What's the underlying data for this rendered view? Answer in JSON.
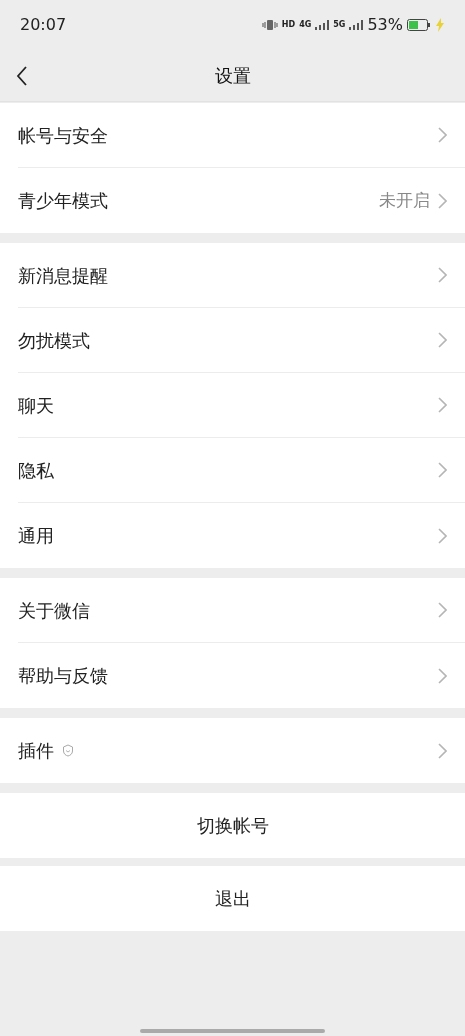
{
  "status_bar": {
    "time": "20:07",
    "network_labels": [
      "HD",
      "4G",
      "5G"
    ],
    "battery": "53%"
  },
  "nav": {
    "title": "设置"
  },
  "groups": [
    {
      "items": [
        {
          "kind": "link",
          "label": "帐号与安全"
        },
        {
          "kind": "link",
          "label": "青少年模式",
          "value": "未开启"
        }
      ]
    },
    {
      "items": [
        {
          "kind": "link",
          "label": "新消息提醒"
        },
        {
          "kind": "link",
          "label": "勿扰模式"
        },
        {
          "kind": "link",
          "label": "聊天"
        },
        {
          "kind": "link",
          "label": "隐私"
        },
        {
          "kind": "link",
          "label": "通用"
        }
      ]
    },
    {
      "items": [
        {
          "kind": "link",
          "label": "关于微信"
        },
        {
          "kind": "link",
          "label": "帮助与反馈"
        }
      ]
    },
    {
      "items": [
        {
          "kind": "shield",
          "label": "插件"
        }
      ]
    }
  ],
  "actions": [
    {
      "label": "切换帐号"
    },
    {
      "label": "退出"
    }
  ]
}
